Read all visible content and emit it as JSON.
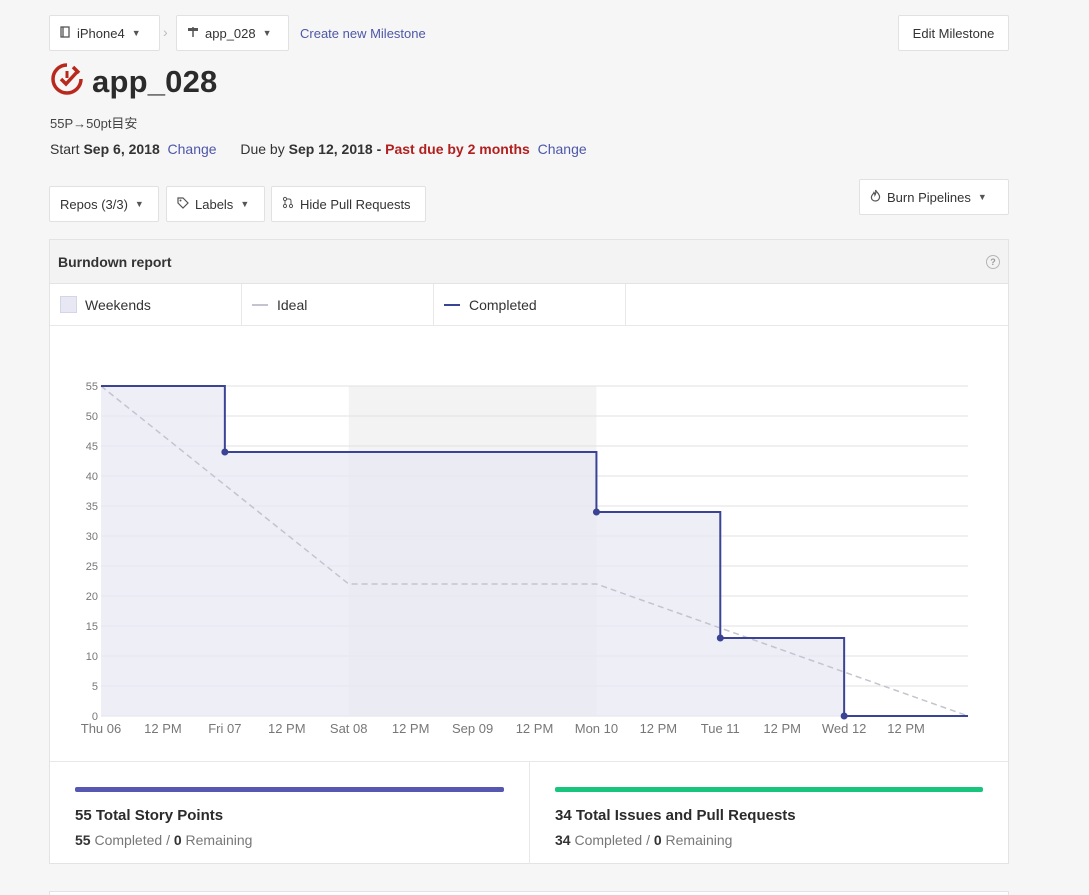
{
  "nav": {
    "workspace": "iPhone4",
    "milestone_select": "app_028",
    "create_link": "Create new Milestone",
    "edit_button": "Edit Milestone"
  },
  "milestone": {
    "title": "app_028",
    "description": "55P→50pt目安",
    "start_label": "Start",
    "start_date": "Sep 6, 2018",
    "change_label": "Change",
    "due_label": "Due by",
    "due_date": "Sep 12, 2018",
    "dash": "-",
    "past_due": "Past due by 2 months"
  },
  "filters": {
    "repos": "Repos (3/3)",
    "labels": "Labels",
    "hide_prs": "Hide Pull Requests",
    "burn": "Burn Pipelines"
  },
  "report": {
    "title": "Burndown report",
    "legend": {
      "weekends": "Weekends",
      "ideal": "Ideal",
      "completed": "Completed"
    }
  },
  "colors": {
    "completed": "#3b4494",
    "ideal": "#c4c4d0",
    "fill": "#e8e8f4",
    "weekend": "#f3f3f3",
    "blue_bar": "#5557b0",
    "green_bar": "#17c67c",
    "past_due": "#b21f1f"
  },
  "chart_data": {
    "type": "line",
    "x_ticks": [
      "Thu 06",
      "12 PM",
      "Fri 07",
      "12 PM",
      "Sat 08",
      "12 PM",
      "Sep 09",
      "12 PM",
      "Mon 10",
      "12 PM",
      "Tue 11",
      "12 PM",
      "Wed 12",
      "12 PM"
    ],
    "y_ticks": [
      0,
      5,
      10,
      15,
      20,
      25,
      30,
      35,
      40,
      45,
      50,
      55
    ],
    "xlim": [
      "2018-09-06 00:00",
      "2018-09-13 00:00"
    ],
    "ylim": [
      0,
      55
    ],
    "weekend": [
      "2018-09-08 00:00",
      "2018-09-10 00:00"
    ],
    "series": [
      {
        "name": "Completed",
        "step": true,
        "points": [
          [
            "2018-09-06 00:00",
            55
          ],
          [
            "2018-09-07 00:00",
            44
          ],
          [
            "2018-09-10 00:00",
            34
          ],
          [
            "2018-09-11 00:00",
            13
          ],
          [
            "2018-09-12 00:00",
            0
          ],
          [
            "2018-09-13 00:00",
            0
          ]
        ],
        "markers": [
          [
            "2018-09-07 00:00",
            44
          ],
          [
            "2018-09-10 00:00",
            34
          ],
          [
            "2018-09-11 00:00",
            13
          ],
          [
            "2018-09-12 00:00",
            0
          ]
        ]
      },
      {
        "name": "Ideal",
        "points": [
          [
            "2018-09-06 00:00",
            55
          ],
          [
            "2018-09-08 00:00",
            22
          ],
          [
            "2018-09-10 00:00",
            22
          ],
          [
            "2018-09-13 00:00",
            0
          ]
        ]
      }
    ]
  },
  "stats": {
    "points": {
      "title": "55 Total Story Points",
      "completed": "55",
      "completed_label": "Completed",
      "sep": "/",
      "remaining": "0",
      "remaining_label": "Remaining",
      "progress": 1.0
    },
    "issues": {
      "title": "34 Total Issues and Pull Requests",
      "completed": "34",
      "completed_label": "Completed",
      "sep": "/",
      "remaining": "0",
      "remaining_label": "Remaining",
      "progress": 1.0
    }
  }
}
